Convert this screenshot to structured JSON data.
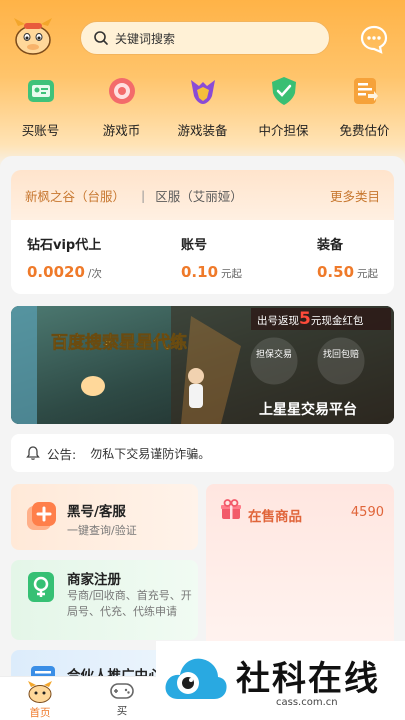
{
  "search": {
    "placeholder": "关键词搜索"
  },
  "categories": [
    {
      "label": "买账号",
      "icon": "account-icon"
    },
    {
      "label": "游戏币",
      "icon": "coin-icon"
    },
    {
      "label": "游戏装备",
      "icon": "equipment-icon"
    },
    {
      "label": "中介担保",
      "icon": "guarantee-icon"
    },
    {
      "label": "免费估价",
      "icon": "valuation-icon"
    }
  ],
  "server": {
    "game": "新枫之谷（台服）",
    "separator": "|",
    "region": "区服（艾丽娅）",
    "more": "更多类目"
  },
  "prices": [
    {
      "title": "钻石vip代上",
      "value": "0.0020",
      "unit": "/次"
    },
    {
      "title": "账号",
      "value": "0.10",
      "unit": "元起"
    },
    {
      "title": "装备",
      "value": "0.50",
      "unit": "元起"
    }
  ],
  "banner": {
    "left_title": "百度搜索星星代练",
    "top_right": "出号返现",
    "highlight": "5",
    "top_right_suffix": "元现金红包",
    "bottom_right": "上星星交易平台",
    "badge_left": "担保交易",
    "badge_right": "找回包赔"
  },
  "notice": {
    "label": "公告:",
    "text": "勿私下交易谨防诈骗。"
  },
  "cards": {
    "black": {
      "title": "黑号/客服",
      "sub": "一键查询/验证"
    },
    "merchant": {
      "title": "商家注册",
      "sub": "号商/回收商、首充号、开局号、代充、代练申请"
    },
    "partner": {
      "title": "合伙人推广中心"
    },
    "sale": {
      "title": "在售商品",
      "count": "4590"
    }
  },
  "watermark": {
    "name": "社科在线",
    "url": "cass.com.cn"
  },
  "tabs": [
    {
      "label": "首页"
    },
    {
      "label": "买"
    }
  ],
  "colors": {
    "accent": "#ef7a2a",
    "header": "#ffb347",
    "tab_active": "#ef7a2a"
  }
}
